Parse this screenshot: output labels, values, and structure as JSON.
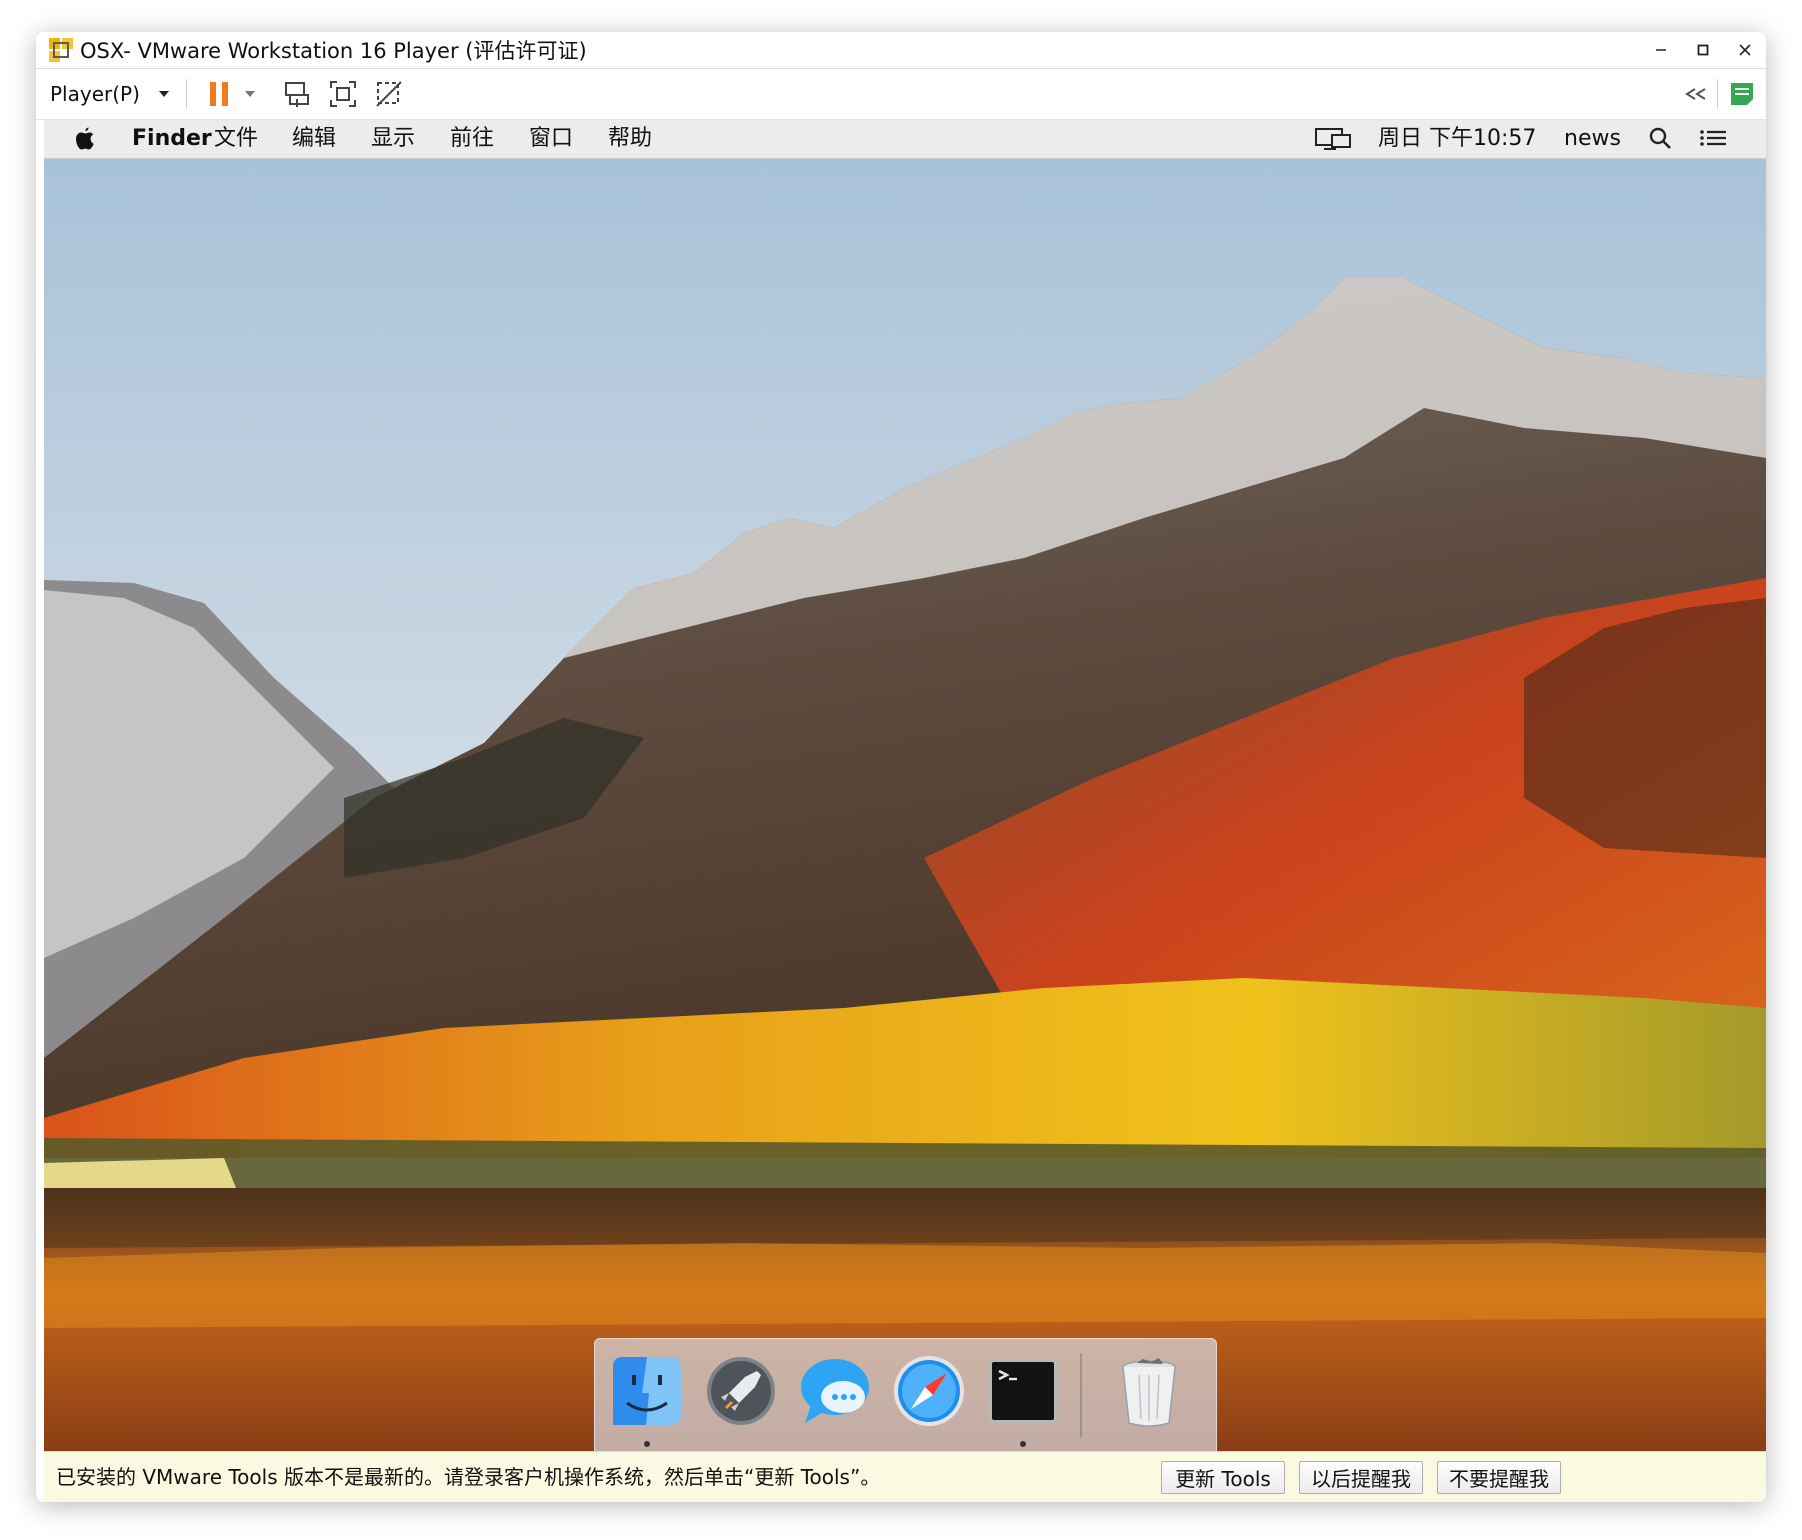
{
  "window": {
    "title": "OSX- VMware Workstation 16 Player (评估许可证)",
    "app_icon": "vmware-icon",
    "controls": [
      "minimize-icon",
      "maximize-icon",
      "close-icon"
    ]
  },
  "toolbar": {
    "player_menu_label": "Player(P)",
    "dropdown_icon": "chevron-down-icon",
    "pause_icon": "pause-icon",
    "send_cad_icon": "send-ctrl-alt-del-icon",
    "fullscreen_icon": "fullscreen-icon",
    "unity_icon": "unity-icon",
    "collapse_icon": "double-chevron-left-icon",
    "notes_icon": "message-log-icon",
    "accent_color": "#f07a1c",
    "notes_color": "#35a853"
  },
  "mac_menubar": {
    "apple_icon": "apple-icon",
    "app_name": "Finder",
    "menus": [
      "文件",
      "编辑",
      "显示",
      "前往",
      "窗口",
      "帮助"
    ],
    "display_icon": "display-icon",
    "clock": "周日 下午10:57",
    "user": "news",
    "search_icon": "spotlight-search-icon",
    "notifications_icon": "notification-center-icon"
  },
  "desktop": {
    "wallpaper": "macOS High Sierra autumn mountains"
  },
  "dock": {
    "items": [
      {
        "name": "finder-icon",
        "running": true
      },
      {
        "name": "launchpad-icon",
        "running": false
      },
      {
        "name": "messages-icon",
        "running": false
      },
      {
        "name": "safari-icon",
        "running": false
      },
      {
        "name": "terminal-icon",
        "running": true
      },
      {
        "name": "trash-icon",
        "running": false
      }
    ]
  },
  "notification": {
    "message": "已安装的 VMware Tools 版本不是最新的。请登录客户机操作系统，然后单击“更新 Tools”。",
    "buttons": [
      "更新 Tools",
      "以后提醒我",
      "不要提醒我"
    ],
    "background": "#fbf9e1"
  }
}
